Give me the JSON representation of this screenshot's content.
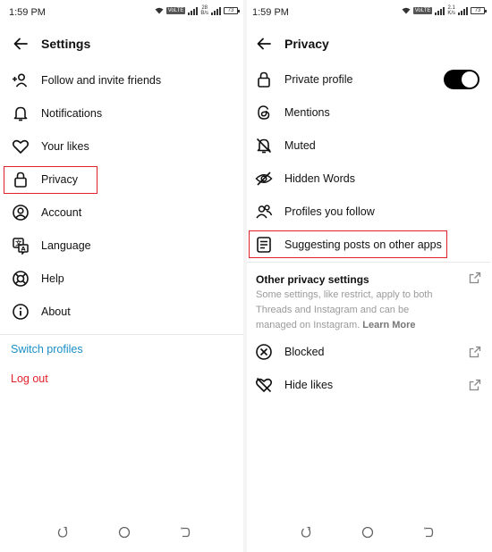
{
  "status_left": {
    "time": "1:59 PM",
    "speed_top": "28",
    "speed_bottom": "B/s",
    "volte": "VoLTE",
    "battery": "73"
  },
  "status_right": {
    "time": "1:59 PM",
    "speed_top": "2.1",
    "speed_bottom": "K/s",
    "volte": "VoLTE",
    "battery": "73"
  },
  "settings": {
    "title": "Settings",
    "items": [
      {
        "label": "Follow and invite friends",
        "icon": "person-add-icon"
      },
      {
        "label": "Notifications",
        "icon": "bell-icon"
      },
      {
        "label": "Your likes",
        "icon": "heart-icon"
      },
      {
        "label": "Privacy",
        "icon": "lock-icon"
      },
      {
        "label": "Account",
        "icon": "account-icon"
      },
      {
        "label": "Language",
        "icon": "language-icon"
      },
      {
        "label": "Help",
        "icon": "lifebuoy-icon"
      },
      {
        "label": "About",
        "icon": "info-icon"
      }
    ],
    "switch_profiles": "Switch profiles",
    "log_out": "Log out",
    "link_color": "#1a8fc7",
    "logout_color": "#e0202a"
  },
  "privacy": {
    "title": "Privacy",
    "items": [
      {
        "label": "Private profile",
        "icon": "lock-icon",
        "toggle_on": true
      },
      {
        "label": "Mentions",
        "icon": "threads-icon"
      },
      {
        "label": "Muted",
        "icon": "bell-muted-icon"
      },
      {
        "label": "Hidden Words",
        "icon": "eye-off-icon"
      },
      {
        "label": "Profiles you follow",
        "icon": "people-icon"
      },
      {
        "label": "Suggesting posts on other apps",
        "icon": "document-icon"
      }
    ],
    "other_title": "Other privacy settings",
    "other_desc": "Some settings, like restrict, apply to both Threads and Instagram and can be managed on Instagram.",
    "learn_more": "Learn More",
    "bottom_items": [
      {
        "label": "Blocked",
        "icon": "blocked-icon"
      },
      {
        "label": "Hide likes",
        "icon": "heart-off-icon"
      }
    ]
  },
  "colors": {
    "highlight": "#e0202a",
    "toggle": "#000000"
  }
}
